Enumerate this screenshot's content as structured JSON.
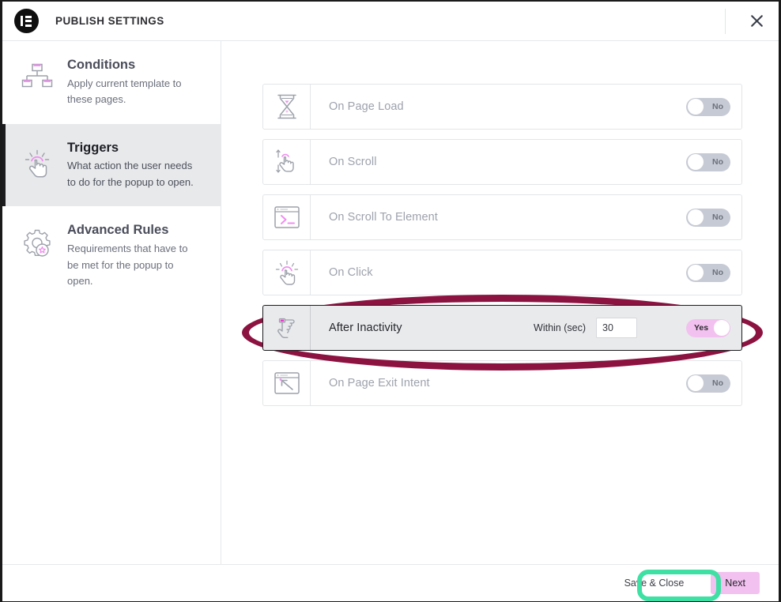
{
  "header": {
    "logo_icon": "elementor-logo-icon",
    "title": "PUBLISH SETTINGS",
    "close_icon": "close-icon"
  },
  "sidebar": {
    "items": [
      {
        "id": "conditions",
        "icon": "sitemap-icon",
        "title": "Conditions",
        "desc": "Apply current template to these pages.",
        "active": false
      },
      {
        "id": "triggers",
        "icon": "tap-hand-icon",
        "title": "Triggers",
        "desc": "What action the user needs to do for the popup to open.",
        "active": true
      },
      {
        "id": "advanced-rules",
        "icon": "gear-star-icon",
        "title": "Advanced Rules",
        "desc": "Requirements that have to be met for the popup to open.",
        "active": false
      }
    ]
  },
  "triggers": [
    {
      "id": "on-page-load",
      "icon": "hourglass-icon",
      "label": "On Page Load",
      "toggle": "No",
      "on": false,
      "has_field": false
    },
    {
      "id": "on-scroll",
      "icon": "scroll-hand-icon",
      "label": "On Scroll",
      "toggle": "No",
      "on": false,
      "has_field": false
    },
    {
      "id": "on-scroll-to-element",
      "icon": "browser-prompt-icon",
      "label": "On Scroll To Element",
      "toggle": "No",
      "on": false,
      "has_field": false
    },
    {
      "id": "on-click",
      "icon": "click-hand-icon",
      "label": "On Click",
      "toggle": "No",
      "on": false,
      "has_field": false
    },
    {
      "id": "after-inactivity",
      "icon": "idle-hand-icon",
      "label": "After Inactivity",
      "toggle": "Yes",
      "on": true,
      "has_field": true,
      "field_label": "Within (sec)",
      "field_value": "30",
      "field_placeholder": ""
    },
    {
      "id": "on-page-exit-intent",
      "icon": "exit-arrow-icon",
      "label": "On Page Exit Intent",
      "toggle": "No",
      "on": false,
      "has_field": false
    }
  ],
  "footer": {
    "save_label": "Save & Close",
    "next_label": "Next"
  },
  "annotations": {
    "ellipse_color": "#8c1240",
    "rect_color": "#3ee0a4"
  },
  "colors": {
    "accent_pink": "#f2c1ef",
    "toggle_off": "#c6cad4",
    "active_row_bg": "#e9eaec",
    "sidebar_active_bg": "#e8e9eb"
  }
}
